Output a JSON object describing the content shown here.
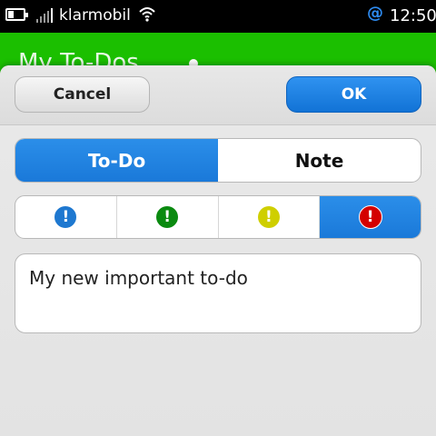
{
  "status_bar": {
    "carrier": "klarmobil",
    "time": "12:50",
    "at_icon": "@",
    "icons": [
      "battery-icon",
      "signal-icon",
      "wifi-icon",
      "at-icon"
    ]
  },
  "background": {
    "title": "My To-Dos"
  },
  "dialog": {
    "cancel_label": "Cancel",
    "ok_label": "OK",
    "type_tabs": [
      {
        "label": "To-Do",
        "active": true
      },
      {
        "label": "Note",
        "active": false
      }
    ],
    "priorities": [
      {
        "icon": "priority-blue-icon",
        "glyph": "!",
        "color": "#1e78d0",
        "active": false
      },
      {
        "icon": "priority-green-icon",
        "glyph": "!",
        "color": "#0a8a10",
        "active": false
      },
      {
        "icon": "priority-yellow-icon",
        "glyph": "!",
        "color": "#cfcf00",
        "active": false
      },
      {
        "icon": "priority-red-icon",
        "glyph": "!",
        "color": "#d40000",
        "active": true
      }
    ],
    "text_value": "My new important to-do"
  },
  "colors": {
    "accent": "#1a79d9",
    "header_green": "#1bbf00"
  }
}
